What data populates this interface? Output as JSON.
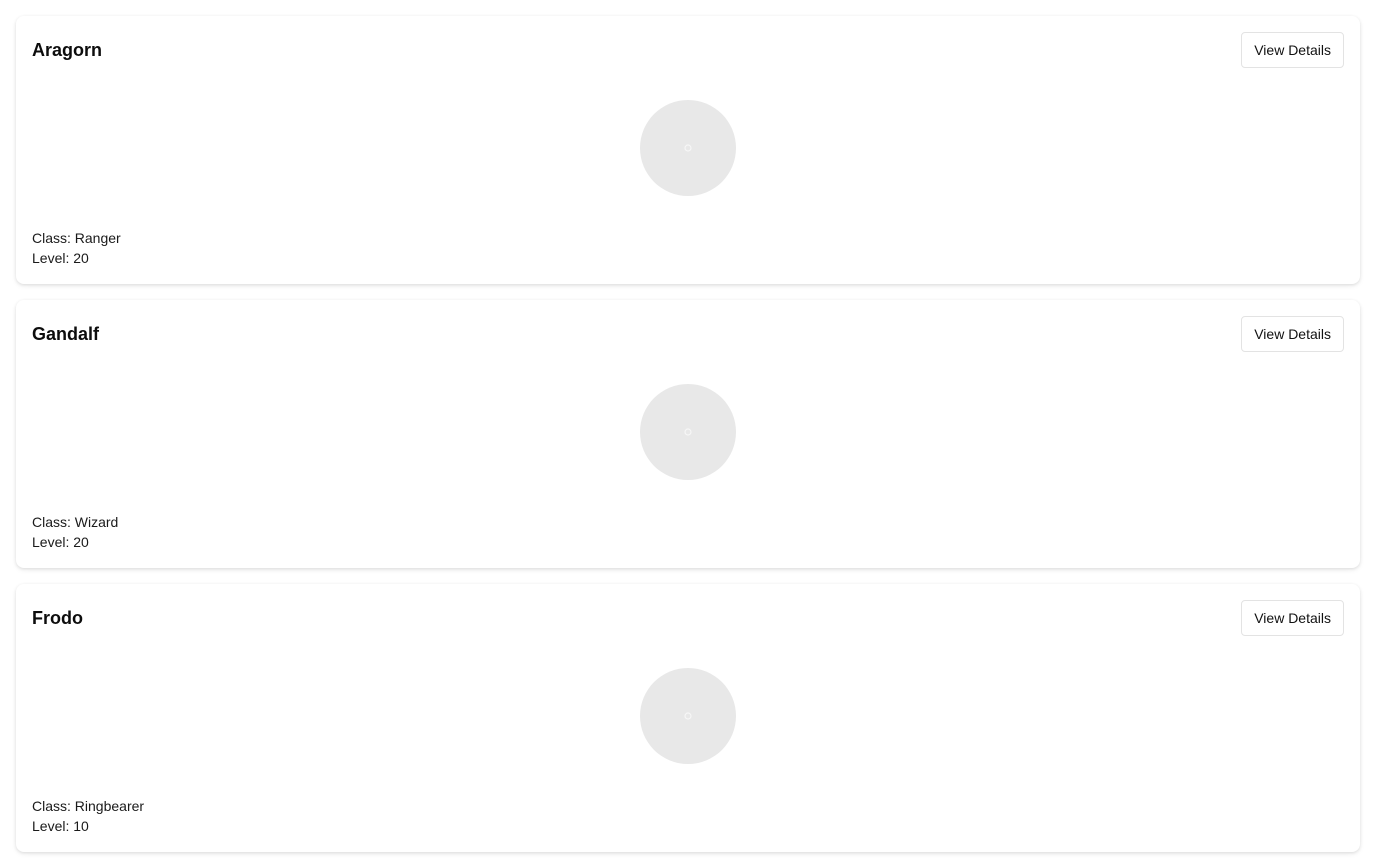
{
  "characters": [
    {
      "name": "Aragorn",
      "button_label": "View Details",
      "class_text": "Class: Ranger",
      "level_text": "Level: 20",
      "avatar_icon": "image-placeholder-icon"
    },
    {
      "name": "Gandalf",
      "button_label": "View Details",
      "class_text": "Class: Wizard",
      "level_text": "Level: 20",
      "avatar_icon": "image-placeholder-icon"
    },
    {
      "name": "Frodo",
      "button_label": "View Details",
      "class_text": "Class: Ringbearer",
      "level_text": "Level: 10",
      "avatar_icon": "image-placeholder-icon"
    }
  ],
  "colors": {
    "avatar_background": "#e8e8e8",
    "button_border": "#e3e3e3"
  }
}
